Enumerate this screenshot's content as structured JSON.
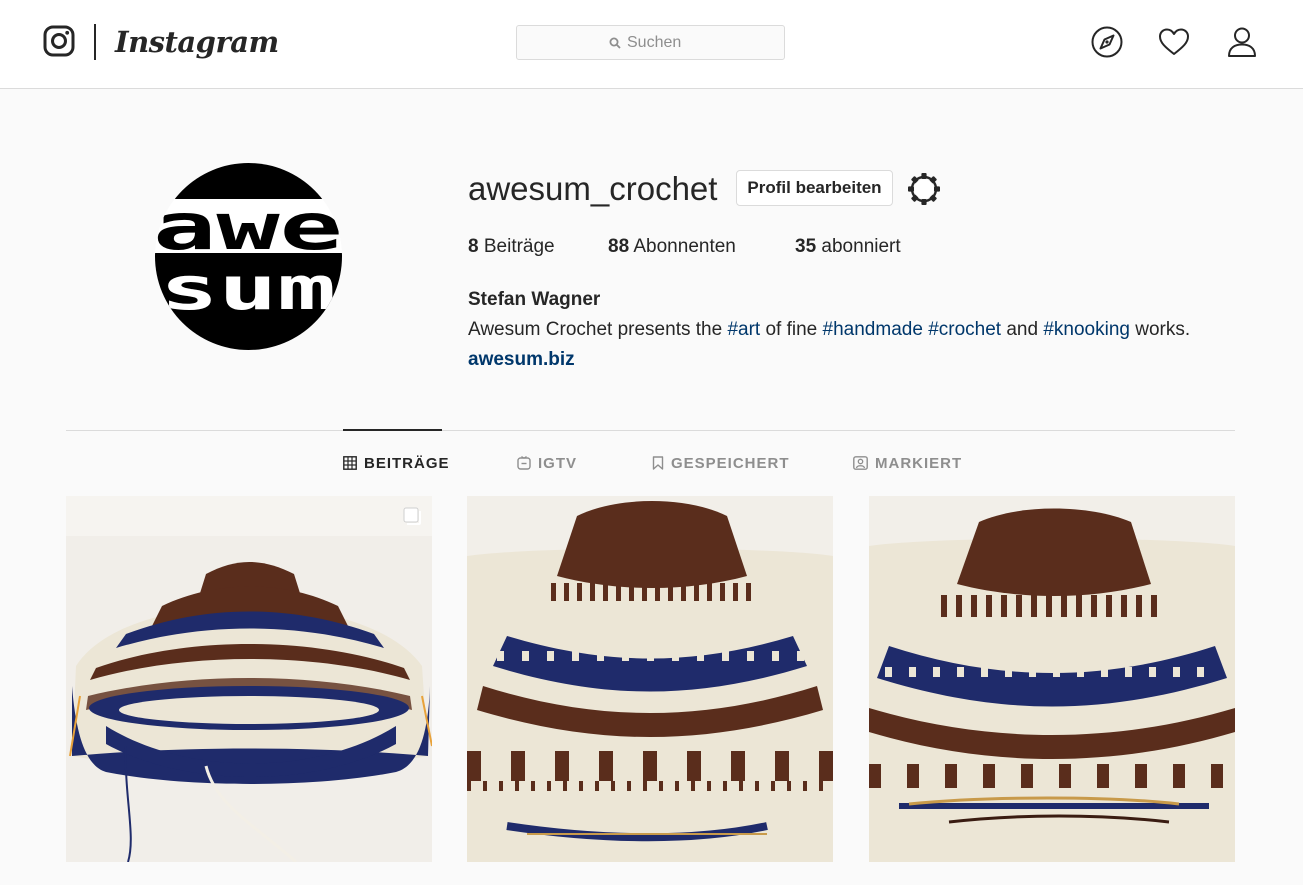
{
  "header": {
    "wordmark": "Instagram",
    "search": {
      "placeholder": "Suchen",
      "value": ""
    },
    "icons": [
      "camera-logo-icon",
      "compass-icon",
      "heart-icon",
      "user-icon"
    ]
  },
  "profile": {
    "username": "awesum_crochet",
    "edit_button": "Profil bearbeiten",
    "settings_icon": "gear-icon",
    "avatar_text": [
      "awe",
      "sum"
    ],
    "stats": [
      {
        "count": "8",
        "label": "Beiträge"
      },
      {
        "count": "88",
        "label": "Abonnenten"
      },
      {
        "count": "35",
        "label": "abonniert"
      }
    ],
    "full_name": "Stefan Wagner",
    "bio": {
      "parts": [
        {
          "text": "Awesum Crochet presents the ",
          "hashtag": false
        },
        {
          "text": "#art",
          "hashtag": true
        },
        {
          "text": " of fine ",
          "hashtag": false
        },
        {
          "text": "#handmade",
          "hashtag": true
        },
        {
          "text": " ",
          "hashtag": false
        },
        {
          "text": "#crochet",
          "hashtag": true
        },
        {
          "text": " and ",
          "hashtag": false
        },
        {
          "text": "#knooking",
          "hashtag": true
        },
        {
          "text": " works.",
          "hashtag": false
        }
      ]
    },
    "website": "awesum.biz"
  },
  "tabs": [
    {
      "label": "BEITRÄGE",
      "icon": "grid-icon",
      "active": true
    },
    {
      "label": "IGTV",
      "icon": "igtv-icon",
      "active": false
    },
    {
      "label": "GESPEICHERT",
      "icon": "bookmark-icon",
      "active": false
    },
    {
      "label": "MARKIERT",
      "icon": "tagged-icon",
      "active": false
    }
  ],
  "posts": [
    {
      "description": "knitted yoke sweater on needles",
      "multi": true
    },
    {
      "description": "knitted yoke sweater close-up",
      "multi": false
    },
    {
      "description": "knitted yoke sweater with circular needle",
      "multi": false
    }
  ],
  "colors": {
    "text": "#262626",
    "muted": "#8e8e8e",
    "link": "#00376b",
    "border": "#dbdbdb",
    "yarn_brown": "#5a2d1c",
    "yarn_navy": "#1f2b6b",
    "yarn_cream": "#ece6d6"
  }
}
